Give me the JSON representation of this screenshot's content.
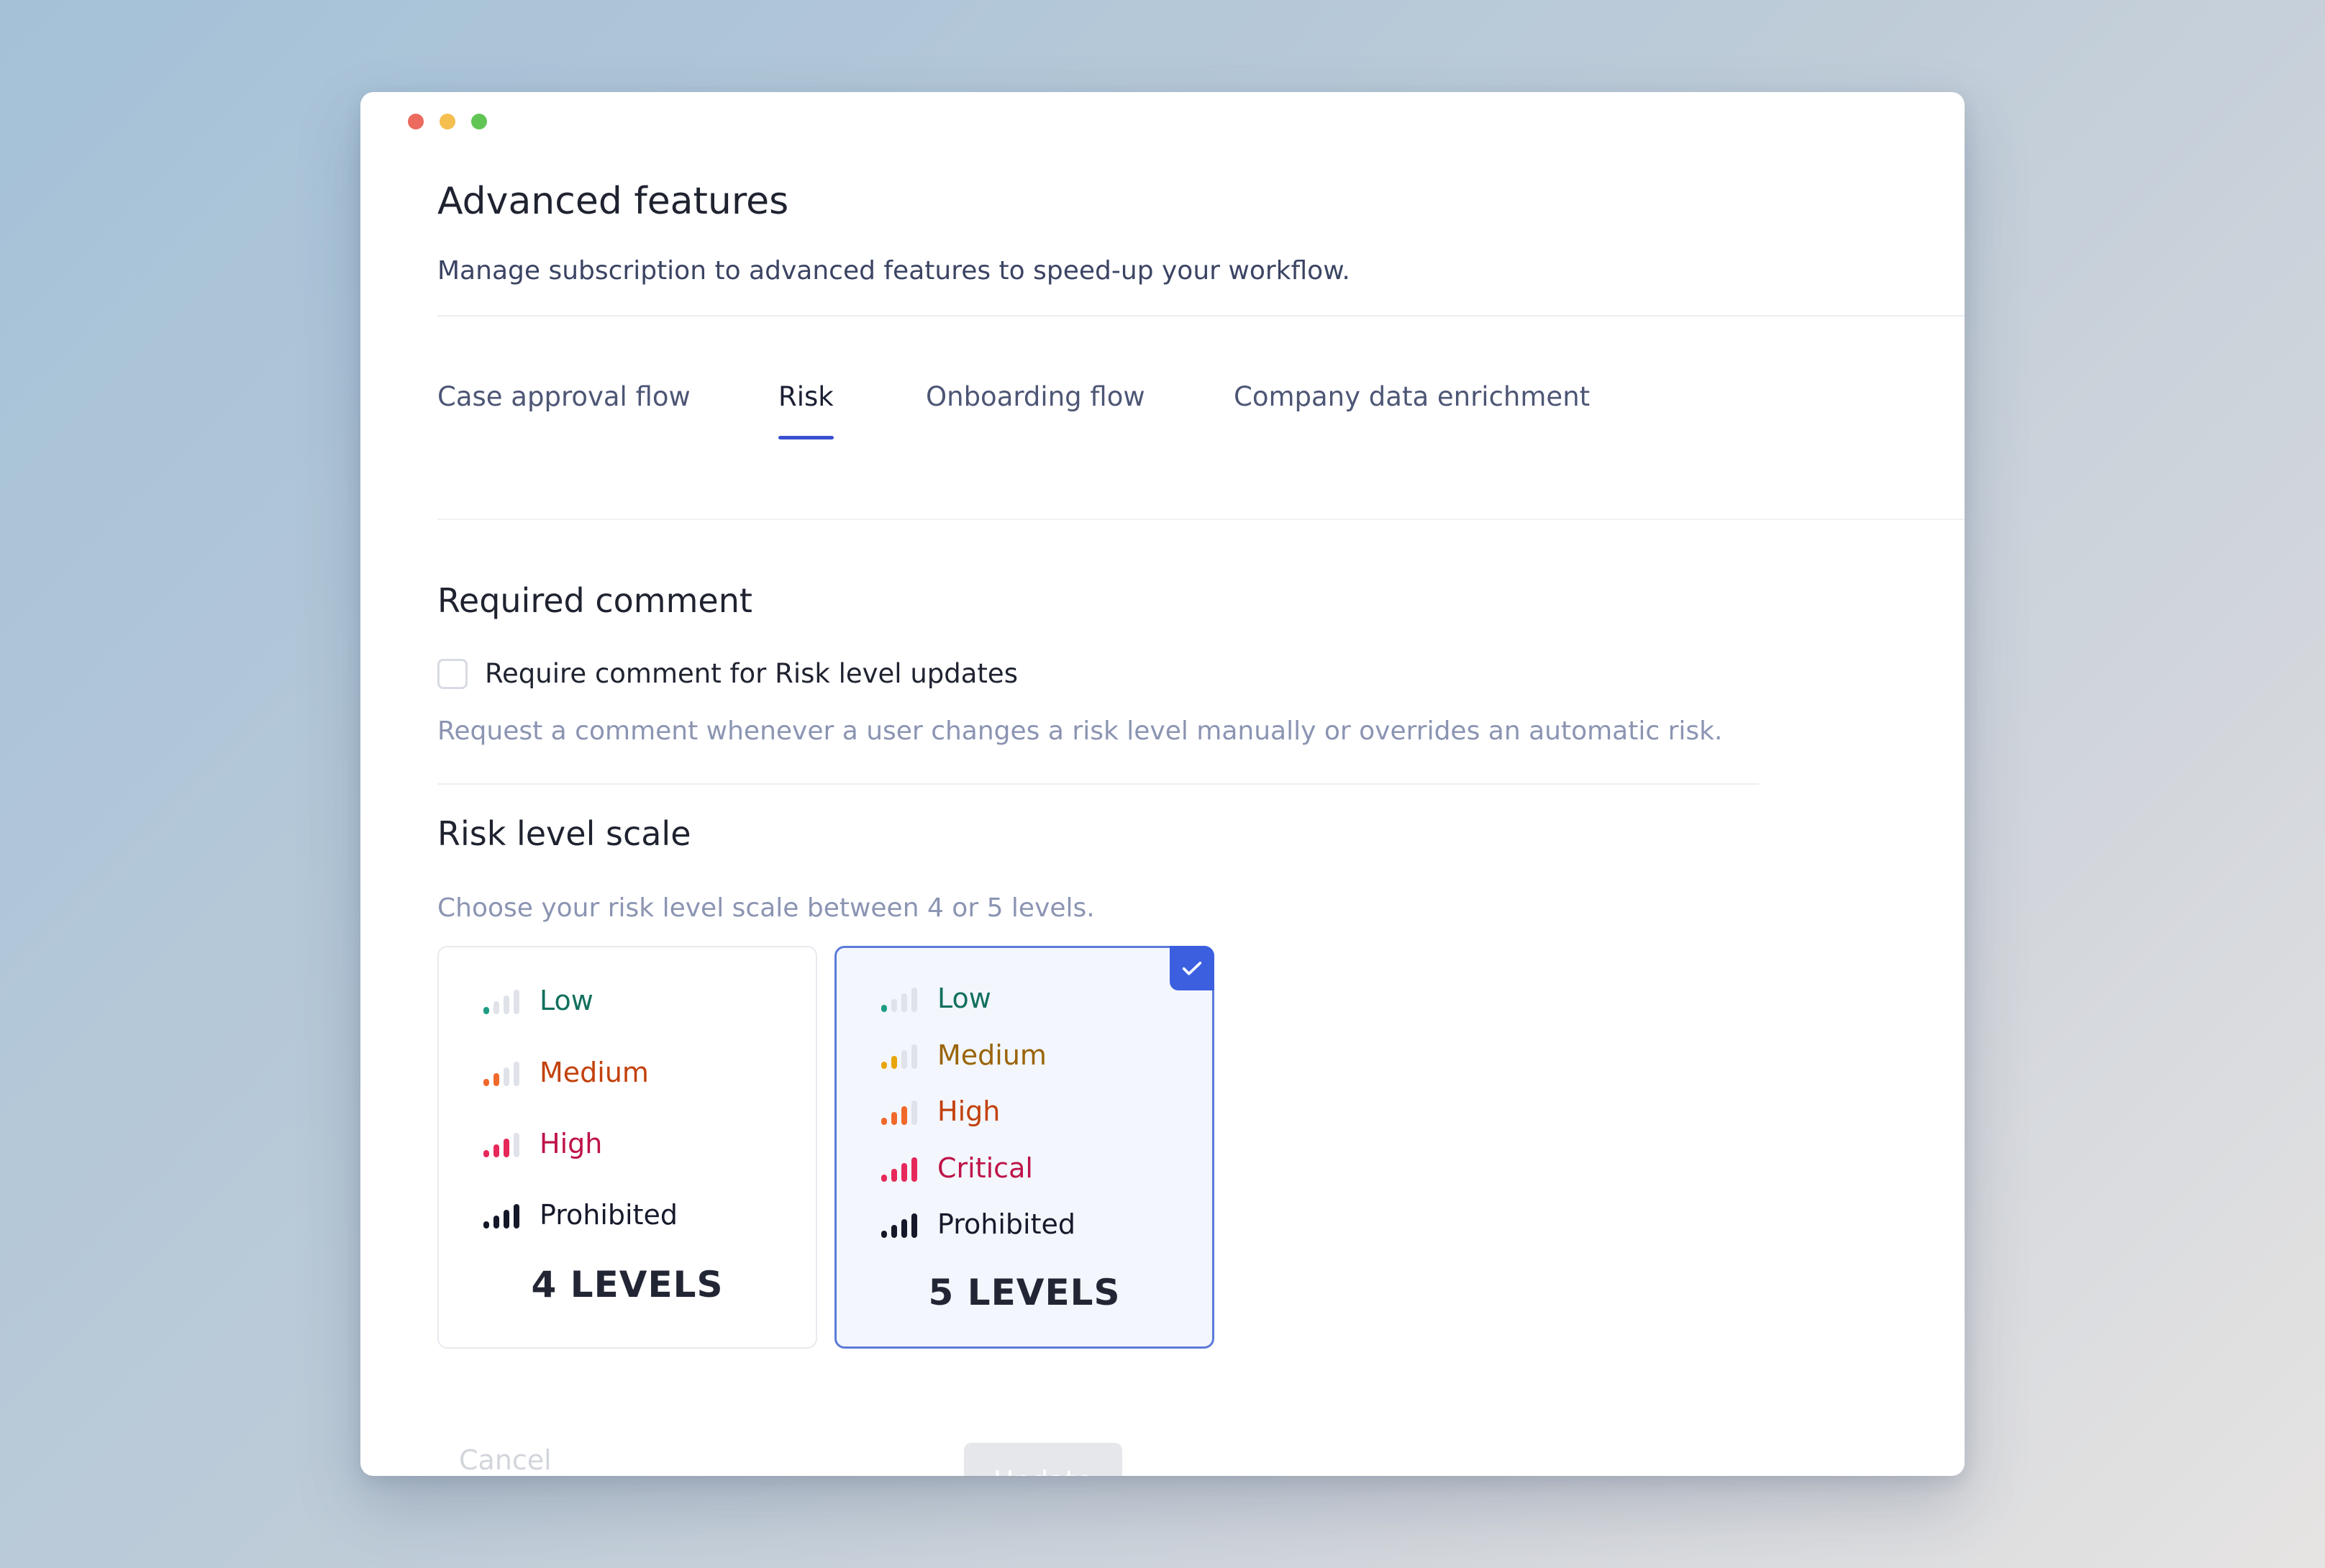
{
  "page": {
    "title": "Advanced features",
    "subtitle": "Manage subscription to advanced features to speed-up your workflow."
  },
  "tabs": [
    {
      "label": "Case approval flow",
      "active": false
    },
    {
      "label": "Risk",
      "active": true
    },
    {
      "label": "Onboarding flow",
      "active": false
    },
    {
      "label": "Company data enrichment",
      "active": false
    }
  ],
  "required_comment": {
    "heading": "Required comment",
    "checkbox_label": "Require comment for Risk level updates",
    "checked": false,
    "hint": "Request a comment whenever a user changes a risk level manually or overrides an automatic risk."
  },
  "risk_scale": {
    "heading": "Risk level scale",
    "hint": "Choose your risk level scale between 4 or 5 levels.",
    "options": [
      {
        "count_label": "4 LEVELS",
        "selected": false,
        "levels": [
          {
            "label": "Low",
            "filled_bars": 1,
            "color": "#1d9c83",
            "text_color": "#12705e"
          },
          {
            "label": "Medium",
            "filled_bars": 2,
            "color": "#f0692b",
            "text_color": "#c2410c"
          },
          {
            "label": "High",
            "filled_bars": 3,
            "color": "#e6285a",
            "text_color": "#be1248"
          },
          {
            "label": "Prohibited",
            "filled_bars": 4,
            "color": "#141828",
            "text_color": "#161a2b"
          }
        ]
      },
      {
        "count_label": "5 LEVELS",
        "selected": true,
        "levels": [
          {
            "label": "Low",
            "filled_bars": 1,
            "color": "#1d9c83",
            "text_color": "#12705e"
          },
          {
            "label": "Medium",
            "filled_bars": 2,
            "color": "#e8a50c",
            "text_color": "#9a6408"
          },
          {
            "label": "High",
            "filled_bars": 3,
            "color": "#f0692b",
            "text_color": "#c2410c"
          },
          {
            "label": "Critical",
            "filled_bars": 4,
            "color": "#e6285a",
            "text_color": "#be1248"
          },
          {
            "label": "Prohibited",
            "filled_bars": 4,
            "color": "#141828",
            "text_color": "#161a2b"
          }
        ]
      }
    ]
  },
  "actions": {
    "cancel_label": "Cancel",
    "update_label": "Update"
  },
  "colors": {
    "accent": "#3a4fd1",
    "selected_border": "#5b7bd9",
    "check_badge": "#3c5fe0",
    "bar_empty": "#dfe2e8"
  },
  "icons": {
    "check_badge": "checkmark-icon",
    "signal": "signal-bars-icon"
  }
}
